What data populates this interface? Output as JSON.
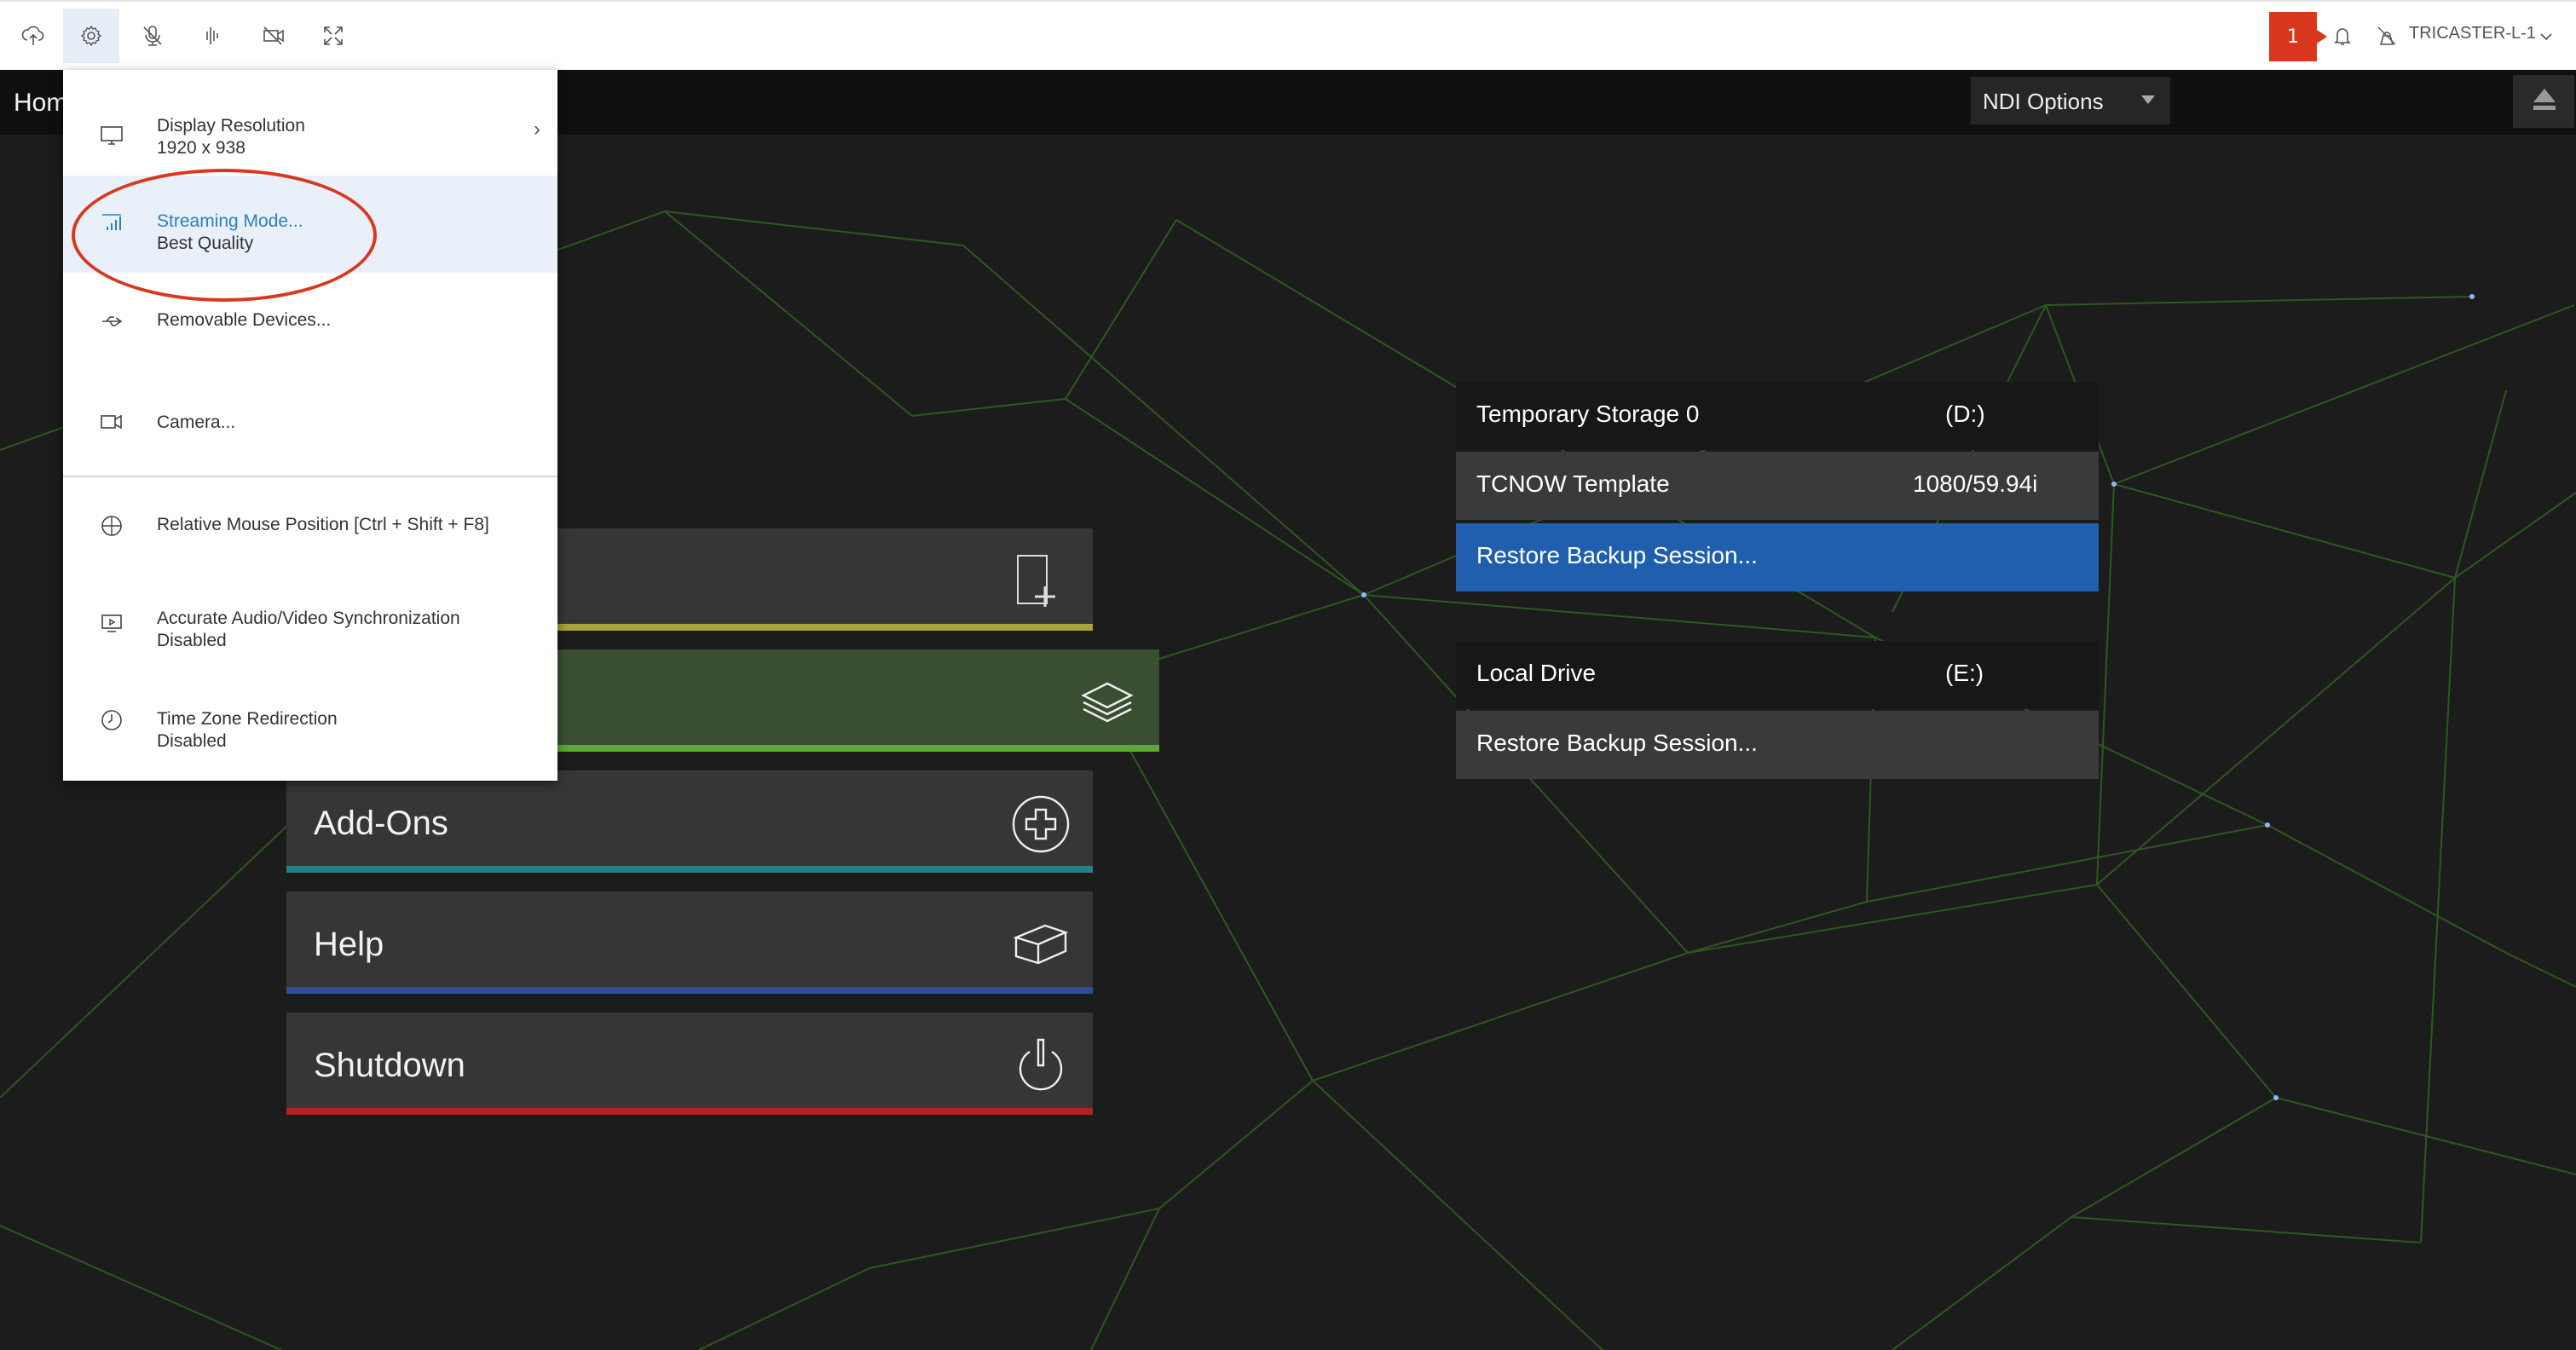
{
  "toolbar": {
    "buttons": [
      {
        "name": "upload",
        "icon": "upload-icon"
      },
      {
        "name": "settings",
        "icon": "gear-icon"
      },
      {
        "name": "microphone-muted",
        "icon": "mic-off-icon"
      },
      {
        "name": "audio",
        "icon": "audio-icon"
      },
      {
        "name": "camera-off",
        "icon": "video-off-icon"
      },
      {
        "name": "fullscreen",
        "icon": "fullscreen-icon"
      }
    ],
    "notification_count": "1",
    "username": "TRICASTER-L-1"
  },
  "header": {
    "home_label": "Hom",
    "ndi_options_label": "NDI Options"
  },
  "settings_menu": {
    "items": [
      {
        "label": "Display Resolution",
        "sublabel": "1920 x 938",
        "icon": "monitor-icon",
        "has_submenu": true
      },
      {
        "label": "Streaming Mode...",
        "sublabel": "Best Quality",
        "icon": "streaming-icon",
        "selected": true
      },
      {
        "label": "Removable Devices...",
        "icon": "usb-icon"
      },
      {
        "label": "Camera...",
        "icon": "camera-icon"
      },
      {
        "label": "Relative Mouse Position [Ctrl + Shift + F8]",
        "icon": "mouse-icon"
      },
      {
        "label": "Accurate Audio/Video Synchronization",
        "sublabel": "Disabled",
        "icon": "av-sync-icon"
      },
      {
        "label": "Time Zone Redirection",
        "sublabel": "Disabled",
        "icon": "clock-icon"
      }
    ],
    "submenu_arrow": "›"
  },
  "main_menu": {
    "items": [
      {
        "label": "",
        "icon": "new-session-icon",
        "color": "#a9a33a"
      },
      {
        "label": "",
        "icon": "layers-icon",
        "color": "#5da83a",
        "active": true
      },
      {
        "label": "Add-Ons",
        "icon": "add-circle-icon",
        "color": "#2a7f86"
      },
      {
        "label": "Help",
        "icon": "book-icon",
        "color": "#2b4f9a"
      },
      {
        "label": "Shutdown",
        "icon": "power-icon",
        "color": "#b32222"
      }
    ]
  },
  "sessions": {
    "drive1": {
      "name": "Temporary Storage 0",
      "letter": "(D:)"
    },
    "session1": {
      "name": "TCNOW Template",
      "format": "1080/59.94i"
    },
    "restore1": "Restore Backup Session...",
    "drive2": {
      "name": "Local Drive",
      "letter": "(E:)"
    },
    "restore2": "Restore Backup Session..."
  },
  "colors": {
    "accent_blue": "#1f5fad",
    "notification_red": "#d9381e",
    "web_green": "#3e7a2a"
  }
}
